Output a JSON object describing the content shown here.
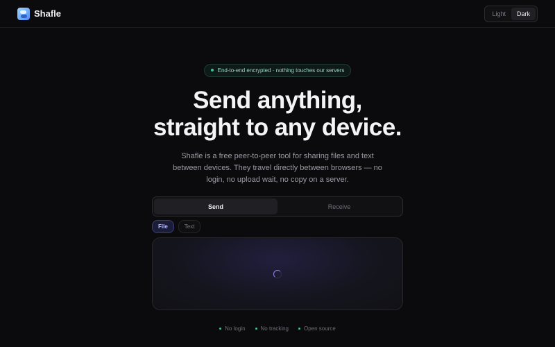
{
  "header": {
    "brand": "Shafle",
    "theme": {
      "light_label": "Light",
      "dark_label": "Dark",
      "active": "dark"
    }
  },
  "hero": {
    "badge": "End-to-end encrypted · nothing touches our servers",
    "title_line1": "Send anything,",
    "title_line2": "straight to any device.",
    "subtitle": "Shafle is a free peer-to-peer tool for sharing files and text between devices. They travel directly between browsers — no login, no upload wait, no copy on a server."
  },
  "transfer": {
    "tabs": [
      {
        "label": "Send",
        "active": true
      },
      {
        "label": "Receive",
        "active": false
      }
    ],
    "modes": [
      {
        "label": "File",
        "active": true
      },
      {
        "label": "Text",
        "active": false
      }
    ]
  },
  "features": [
    "No login",
    "No tracking",
    "Open source"
  ],
  "colors": {
    "background": "#0b0b0d",
    "accent_green": "#35c79a",
    "accent_indigo": "#8e86f0"
  },
  "icons": {
    "logo": "shafle-logo-icon",
    "loading": "spinner-icon"
  }
}
